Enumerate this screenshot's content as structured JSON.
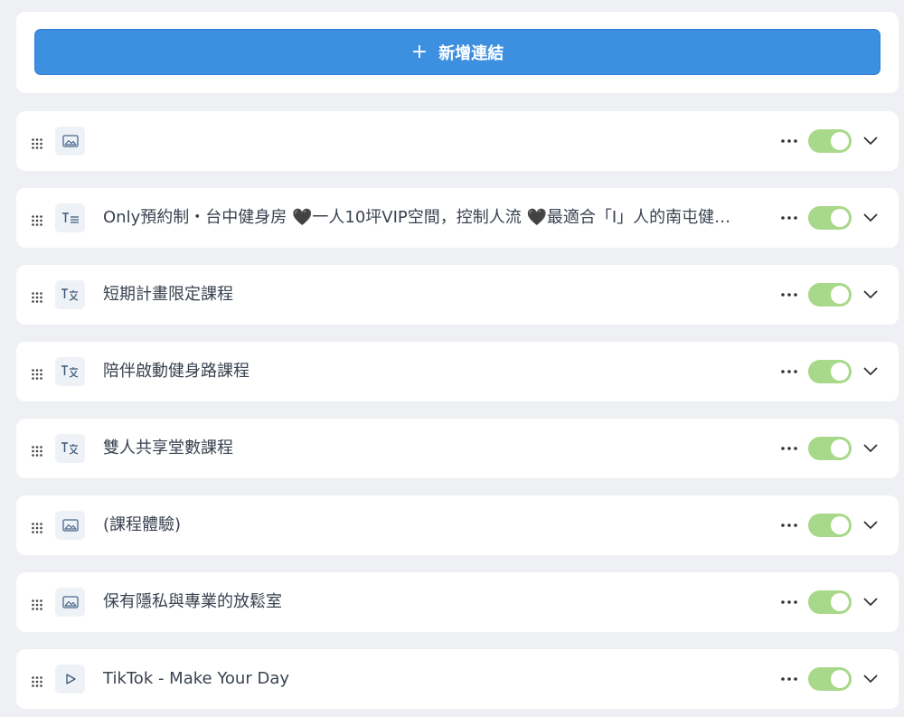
{
  "add_button": {
    "label": "新增連結",
    "icon": "plus-icon"
  },
  "colors": {
    "accent": "#3d8fe0",
    "toggle_on": "#a8d889",
    "icon_bg": "#eef1f6",
    "text": "#3a4250",
    "background": "#eef0f3"
  },
  "links": [
    {
      "type": "image",
      "icon": "image-icon",
      "title": "",
      "enabled": true
    },
    {
      "type": "text",
      "icon": "text-block-icon",
      "title": "Only預約制・台中健身房 🖤一人10坪VIP空間，控制人流 🖤最適合「I」人的南屯健…",
      "enabled": true
    },
    {
      "type": "translate-text",
      "icon": "text-translate-icon",
      "title": "短期計畫限定課程",
      "enabled": true
    },
    {
      "type": "translate-text",
      "icon": "text-translate-icon",
      "title": "陪伴啟動健身路課程",
      "enabled": true
    },
    {
      "type": "translate-text",
      "icon": "text-translate-icon",
      "title": "雙人共享堂數課程",
      "enabled": true
    },
    {
      "type": "image",
      "icon": "image-icon",
      "title": "(課程體驗)",
      "enabled": true
    },
    {
      "type": "image",
      "icon": "image-icon",
      "title": "保有隱私與專業的放鬆室",
      "enabled": true
    },
    {
      "type": "video",
      "icon": "play-icon",
      "title": "TikTok - Make Your Day",
      "enabled": true
    }
  ]
}
